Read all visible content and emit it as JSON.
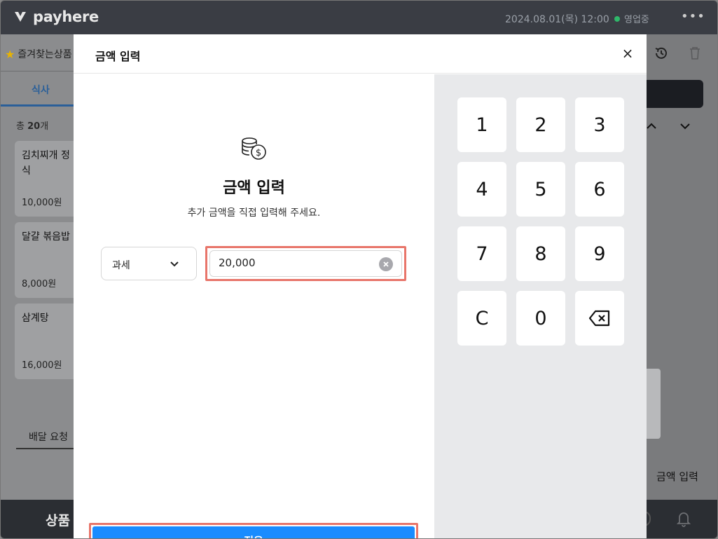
{
  "app": {
    "brand": "payhere",
    "datetime": "2024.08.01(목) 12:00",
    "status": "영업중",
    "more": "•••"
  },
  "background": {
    "favorites_label": "즐겨찾는상품",
    "tab_label": "식사",
    "total_prefix": "총 ",
    "total_count": "20",
    "total_suffix": "개",
    "menu_items": [
      {
        "name": "김치찌개 정식",
        "price": "10,000원"
      },
      {
        "name": "달걀 볶음밥",
        "price": "8,000원"
      },
      {
        "name": "삼계탕",
        "price": "16,000원"
      }
    ],
    "delivery_label": "배달 요청",
    "bottom_label": "상품",
    "right_amount_label": "금액 입력"
  },
  "modal": {
    "header_title": "금액 입력",
    "close_symbol": "×",
    "title": "금액 입력",
    "subtitle": "추가 금액을 직접 입력해 주세요.",
    "tax_type": "과세",
    "amount_value": "20,000",
    "apply_label": "적용"
  },
  "keypad": {
    "keys": [
      "1",
      "2",
      "3",
      "4",
      "5",
      "6",
      "7",
      "8",
      "9",
      "C",
      "0",
      "⌫"
    ]
  },
  "colors": {
    "accent": "#1a8cff",
    "highlight": "#e8756a",
    "topbar": "#3a3d44",
    "status_dot": "#2fb86a"
  }
}
